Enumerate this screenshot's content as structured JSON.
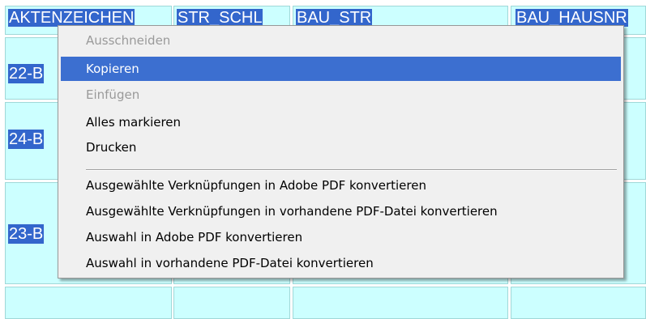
{
  "table": {
    "headers": [
      "AKTENZEICHEN",
      "STR_SCHL",
      "BAU_STR",
      "BAU_HAUSNR"
    ],
    "rows": [
      "22-B",
      "24-B",
      "23-B"
    ]
  },
  "context_menu": {
    "items": [
      {
        "label": "Ausschneiden",
        "state": "disabled"
      },
      {
        "label": "Kopieren",
        "state": "selected"
      },
      {
        "label": "Einfügen",
        "state": "disabled"
      },
      {
        "label": "Alles markieren",
        "state": "enabled"
      },
      {
        "label": "Drucken",
        "state": "enabled"
      },
      {
        "label": "Ausgewählte Verknüpfungen in Adobe PDF konvertieren",
        "state": "enabled"
      },
      {
        "label": "Ausgewählte Verknüpfungen in vorhandene PDF-Datei konvertieren",
        "state": "enabled"
      },
      {
        "label": "Auswahl in Adobe PDF konvertieren",
        "state": "enabled"
      },
      {
        "label": "Auswahl in vorhandene PDF-Datei konvertieren",
        "state": "enabled"
      }
    ]
  },
  "colors": {
    "cell_background": "#ccffff",
    "selection": "#3366cc",
    "menu_highlight": "#3c6fd0",
    "menu_background": "#f0f0f0",
    "disabled_text": "#9a9a9a"
  }
}
